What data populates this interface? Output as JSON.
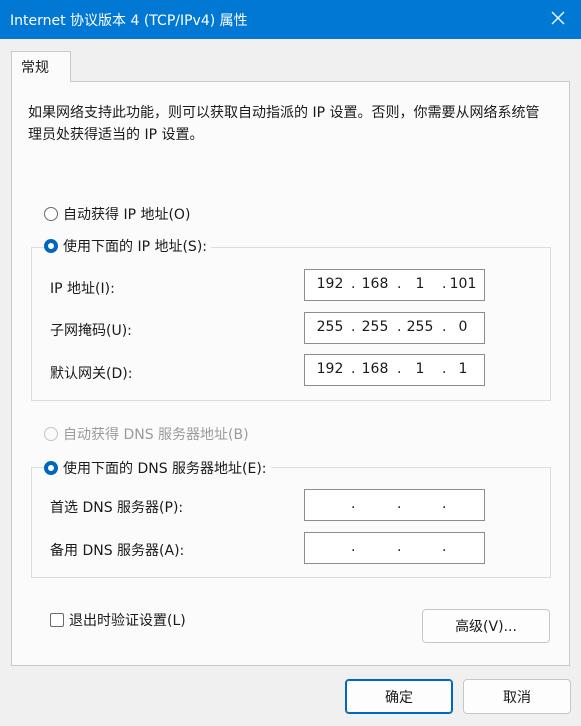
{
  "window": {
    "title": "Internet 协议版本 4 (TCP/IPv4) 属性",
    "close_icon": "close-icon"
  },
  "tabs": [
    {
      "label": "常规",
      "selected": true
    }
  ],
  "description": "如果网络支持此功能，则可以获取自动指派的 IP 设置。否则，你需要从网络系统管理员处获得适当的 IP 设置。",
  "ip": {
    "auto_label": "自动获得 IP 地址(O)",
    "auto_selected": false,
    "manual_label": "使用下面的 IP 地址(S):",
    "manual_selected": true,
    "fields": [
      {
        "label": "IP 地址(I):",
        "octets": [
          "192",
          "168",
          "1",
          "101"
        ]
      },
      {
        "label": "子网掩码(U):",
        "octets": [
          "255",
          "255",
          "255",
          "0"
        ]
      },
      {
        "label": "默认网关(D):",
        "octets": [
          "192",
          "168",
          "1",
          "1"
        ]
      }
    ]
  },
  "dns": {
    "auto_label": "自动获得 DNS 服务器地址(B)",
    "auto_selected": false,
    "auto_disabled": true,
    "manual_label": "使用下面的 DNS 服务器地址(E):",
    "manual_selected": true,
    "fields": [
      {
        "label": "首选 DNS 服务器(P):",
        "octets": [
          "",
          "",
          "",
          ""
        ]
      },
      {
        "label": "备用 DNS 服务器(A):",
        "octets": [
          "",
          "",
          "",
          ""
        ]
      }
    ]
  },
  "validate": {
    "label": "退出时验证设置(L)",
    "checked": false
  },
  "buttons": {
    "advanced": "高级(V)...",
    "ok": "确定",
    "cancel": "取消"
  },
  "colors": {
    "titlebar": "#0078d4",
    "accent": "#0067c0"
  }
}
